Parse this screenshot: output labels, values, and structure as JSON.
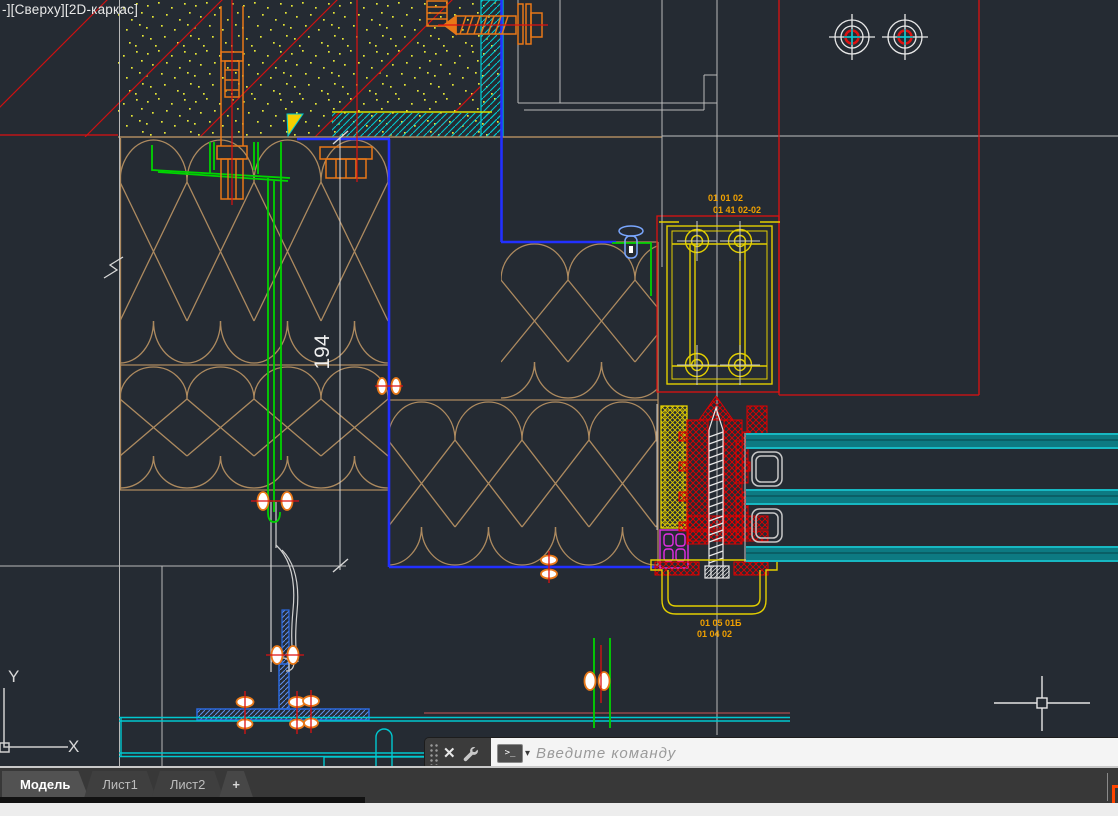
{
  "viewport_controls": {
    "label": "-][Сверху][2D-каркас]"
  },
  "drawing": {
    "dimension_label": "194",
    "part_codes": {
      "top_line1": "01 01 02",
      "top_line2": "01 41 02-02",
      "bottom_line1": "01 05 01Б",
      "bottom_line2": "01 04 02"
    },
    "ucs_icon": {
      "y_label": "Y",
      "x_label": "X"
    }
  },
  "command_bar": {
    "close_glyph": "✕",
    "prompt_glyph": "&gt;_",
    "prompt_text": ">_",
    "dropdown_glyph": "▾",
    "placeholder": "Введите команду"
  },
  "tab_bar": {
    "tabs": [
      {
        "label": "Модель",
        "active": true
      },
      {
        "label": "Лист1",
        "active": false
      },
      {
        "label": "Лист2",
        "active": false
      }
    ],
    "add_tab_label": "+"
  },
  "colors": {
    "canvas_bg": "#252b33",
    "insulation_tan": "#ad8a5f",
    "profile_yellow": "#e3cf00",
    "line_red": "#dd1111",
    "line_blue": "#2230ff",
    "line_green": "#00d400",
    "line_cyan": "#00c8d0",
    "bolt_orange": "#e87818",
    "glass_teal": "#0d7a82",
    "code_orange": "#f0a000"
  }
}
